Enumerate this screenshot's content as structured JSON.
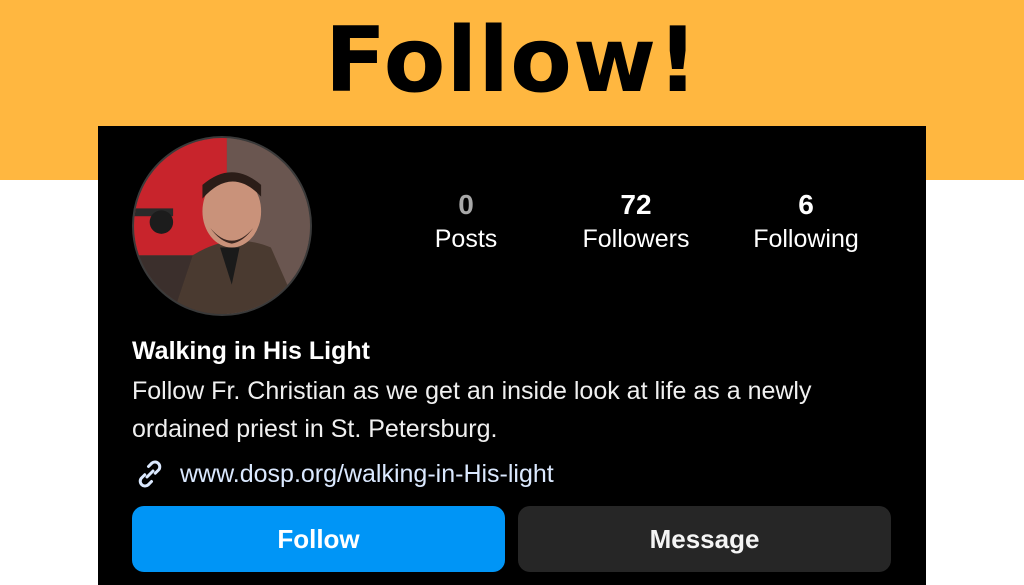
{
  "banner": {
    "title": "Follow!",
    "background": "#FFB740"
  },
  "profile": {
    "avatar_alt": "profile-photo",
    "stats": [
      {
        "value": "0",
        "label": "Posts"
      },
      {
        "value": "72",
        "label": "Followers"
      },
      {
        "value": "6",
        "label": "Following"
      }
    ],
    "name": "Walking in His Light",
    "bio": "Follow Fr. Christian as we get an inside look at life as a newly ordained priest in St. Petersburg.",
    "link": {
      "icon": "link-icon",
      "text": "www.dosp.org/walking-in-His-light"
    },
    "buttons": {
      "follow_label": "Follow",
      "message_label": "Message"
    }
  },
  "colors": {
    "follow_button": "#0095F6",
    "message_button": "#262626",
    "card_background": "#000000"
  }
}
